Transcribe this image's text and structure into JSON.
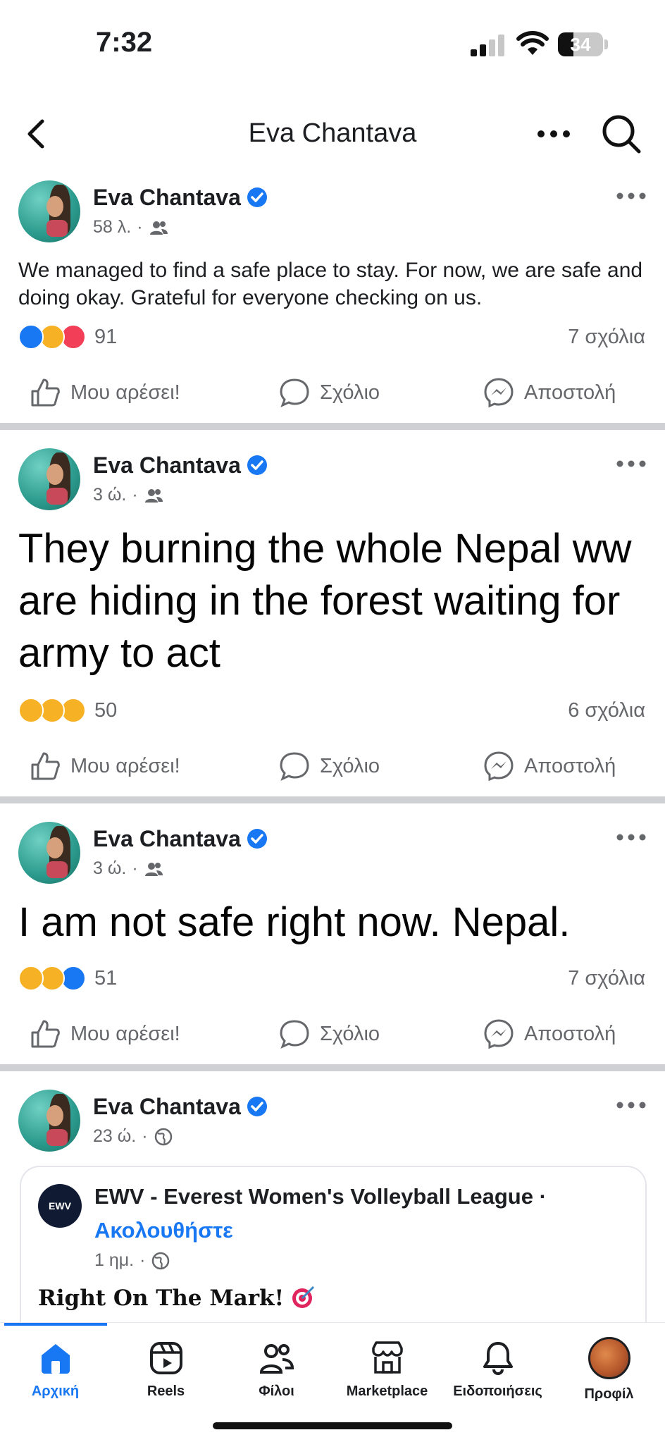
{
  "status_bar": {
    "time": "7:32",
    "battery": "34"
  },
  "header": {
    "title": "Eva Chantava"
  },
  "posts": [
    {
      "author": "Eva Chantava",
      "time": "58 λ.",
      "audience_icon": "friends-icon",
      "text": "We managed to find a safe place to stay. For now, we are safe and doing okay. Grateful for everyone checking on us.",
      "reactions": [
        "like",
        "care",
        "love"
      ],
      "reaction_count": "91",
      "comments": "7 σχόλια"
    },
    {
      "author": "Eva Chantava",
      "time": "3 ώ.",
      "audience_icon": "friends-icon",
      "text": "They burning the whole Nepal ww are hiding in the forest waiting for army to act",
      "reactions": [
        "wow",
        "sad",
        "care"
      ],
      "reaction_count": "50",
      "comments": "6 σχόλια"
    },
    {
      "author": "Eva Chantava",
      "time": "3 ώ.",
      "audience_icon": "friends-icon",
      "text": "I am not safe right now. Nepal.",
      "reactions": [
        "sad",
        "wow",
        "like"
      ],
      "reaction_count": "51",
      "comments": "7 σχόλια"
    },
    {
      "author": "Eva Chantava",
      "time": "23 ώ.",
      "audience_icon": "globe-icon",
      "shared": {
        "page": "EWV - Everest Women's Volleyball League ·",
        "follow": "Ακολουθήστε",
        "time": "1 ημ.",
        "text": "Right On The Mark!"
      }
    }
  ],
  "actions": {
    "like": "Μου αρέσει!",
    "comment": "Σχόλιο",
    "share": "Αποστολή"
  },
  "tabs": [
    {
      "label": "Αρχική",
      "icon": "home-icon",
      "active": true
    },
    {
      "label": "Reels",
      "icon": "reels-icon"
    },
    {
      "label": "Φίλοι",
      "icon": "friends-tab-icon"
    },
    {
      "label": "Marketplace",
      "icon": "marketplace-icon"
    },
    {
      "label": "Ειδοποιήσεις",
      "icon": "bell-icon"
    },
    {
      "label": "Προφίλ",
      "icon": "profile-avatar"
    }
  ],
  "colors": {
    "accent": "#1877f2",
    "secondary_text": "#65676b",
    "divider": "#ced0d4"
  }
}
